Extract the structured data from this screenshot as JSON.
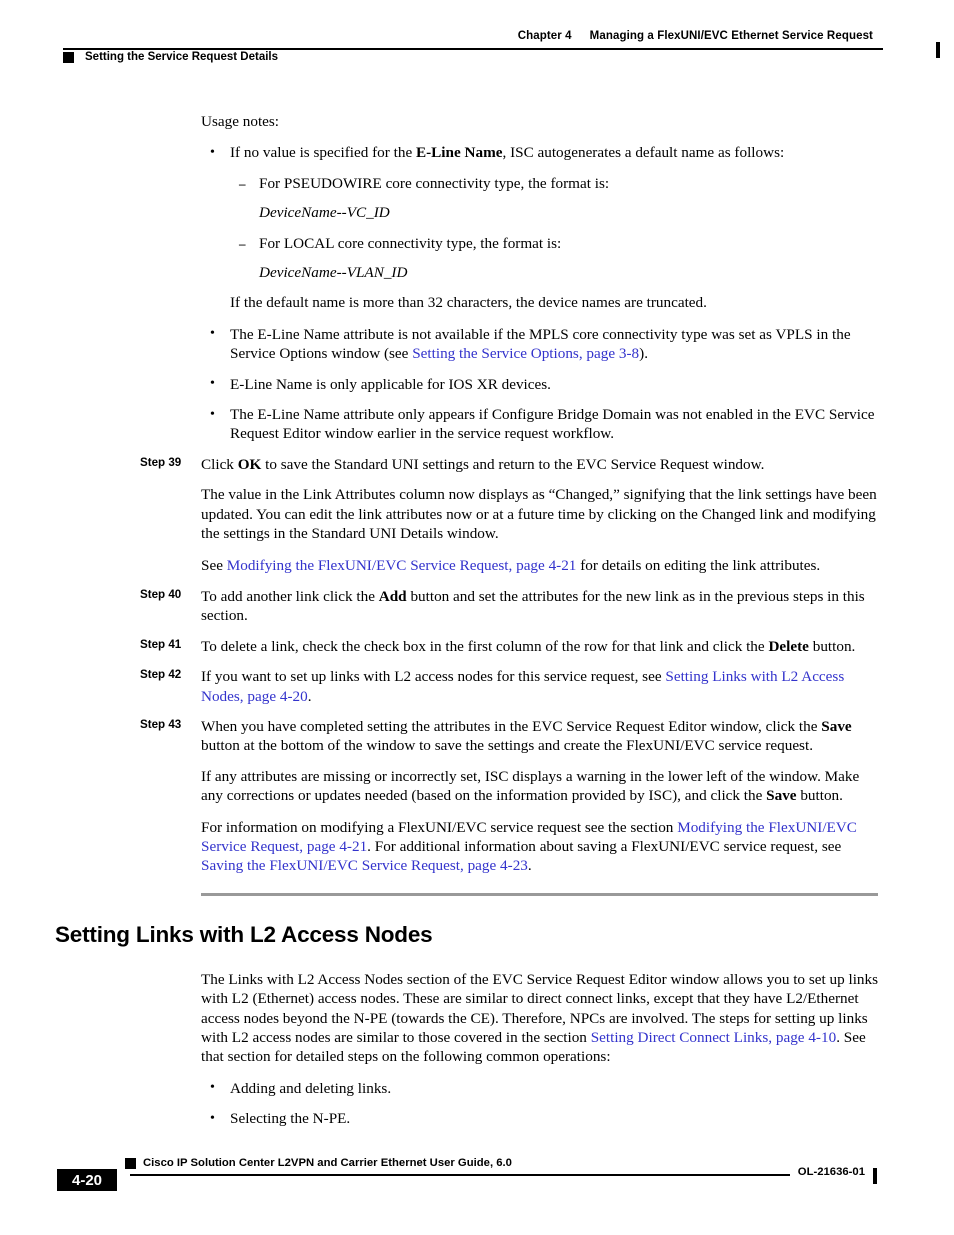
{
  "header": {
    "left_marker": "black-square",
    "left_text": "Setting the Service Request Details",
    "chapter": "Chapter 4",
    "chapter_title": "Managing a FlexUNI/EVC Ethernet Service Request"
  },
  "content": {
    "usage_notes_intro": "Usage notes:",
    "bullet_eline_pre": "If no value is specified for the ",
    "bullet_eline_bold": "E-Line Name",
    "bullet_eline_post": ", ISC autogenerates a default name as follows:",
    "dash_pseudowire": "For PSEUDOWIRE core connectivity type, the format is:",
    "format_pseudowire": "DeviceName--VC_ID",
    "dash_local": "For LOCAL core connectivity type, the format is:",
    "format_local": "DeviceName--VLAN_ID",
    "truncate_note": "If the default name is more than 32 characters, the device names are truncated.",
    "bullet_vpls_pre": "The E-Line Name attribute is not available if the MPLS core connectivity type was set as VPLS in the Service Options window (see ",
    "bullet_vpls_link": "Setting the Service Options, page 3-8",
    "bullet_vpls_post": ").",
    "bullet_iosxr": "E-Line Name is only applicable for IOS XR devices.",
    "bullet_bridge": "The E-Line Name attribute only appears if Configure Bridge Domain was not enabled in the EVC Service Request Editor window earlier in the service request workflow."
  },
  "steps": [
    {
      "label": "Step 39",
      "pre": "Click ",
      "bold": "OK",
      "post": " to save the Standard UNI settings and return to the EVC Service Request window."
    },
    {
      "label": "Step 40",
      "pre": "To add another link click the ",
      "bold": "Add",
      "post": " button and set the attributes for the new link as in the previous steps in this section."
    },
    {
      "label": "Step 41",
      "pre": "To delete a link, check the check box in the first column of the row for that link and click the ",
      "bold": "Delete",
      "post": " button."
    },
    {
      "label": "Step 42",
      "pre": "If you want to set up links with L2 access nodes for this service request, see ",
      "link": "Setting Links with L2 Access Nodes, page 4-20",
      "post": "."
    },
    {
      "label": "Step 43",
      "pre": "When you have completed setting the attributes in the EVC Service Request Editor window, click the ",
      "bold": "Save",
      "post": " button at the bottom of the window to save the settings and create the FlexUNI/EVC service request."
    }
  ],
  "step39_followups": {
    "link_attrs_para": "The value in the Link Attributes column now displays as “Changed,” signifying that the link settings have been updated. You can edit the link attributes now or at a future time by clicking on the Changed link and modifying the settings in the Standard UNI Details window.",
    "see_pre": "See ",
    "see_link": "Modifying the FlexUNI/EVC Service Request, page 4-21",
    "see_post": " for details on editing the link attributes."
  },
  "step43_followups": {
    "warning_pre": "If any attributes are missing or incorrectly set, ISC displays a warning in the lower left of the window. Make any corrections or updates needed (based on the information provided by ISC), and click the ",
    "warning_bold": "Save",
    "warning_post": " button.",
    "info_pre": "For information on modifying a FlexUNI/EVC service request see the section ",
    "info_link1": "Modifying the FlexUNI/EVC Service Request, page 4-21",
    "info_mid": ". For additional information about saving a FlexUNI/EVC service request, see ",
    "info_link2": "Saving the FlexUNI/EVC Service Request, page 4-23",
    "info_post": "."
  },
  "section": {
    "heading": "Setting Links with L2 Access Nodes",
    "para_pre": "The Links with L2 Access Nodes section of the EVC Service Request Editor window allows you to set up links with L2 (Ethernet) access nodes. These are similar to direct connect links, except that they have L2/Ethernet access nodes beyond the N-PE (towards the CE). Therefore, NPCs are involved. The steps for setting up links with L2 access nodes are similar to those covered in the section ",
    "para_link": "Setting Direct Connect Links, page 4-10",
    "para_post": ". See that section for detailed steps on the following common operations:",
    "bullets": [
      "Adding and deleting links.",
      "Selecting the N-PE."
    ]
  },
  "footer": {
    "page_number": "4-20",
    "guide_title": "Cisco IP Solution Center L2VPN and Carrier Ethernet User Guide, 6.0",
    "doc_id": "OL-21636-01"
  },
  "colors": {
    "link": "#3333CC",
    "rule": "#999999",
    "text": "#000000"
  }
}
